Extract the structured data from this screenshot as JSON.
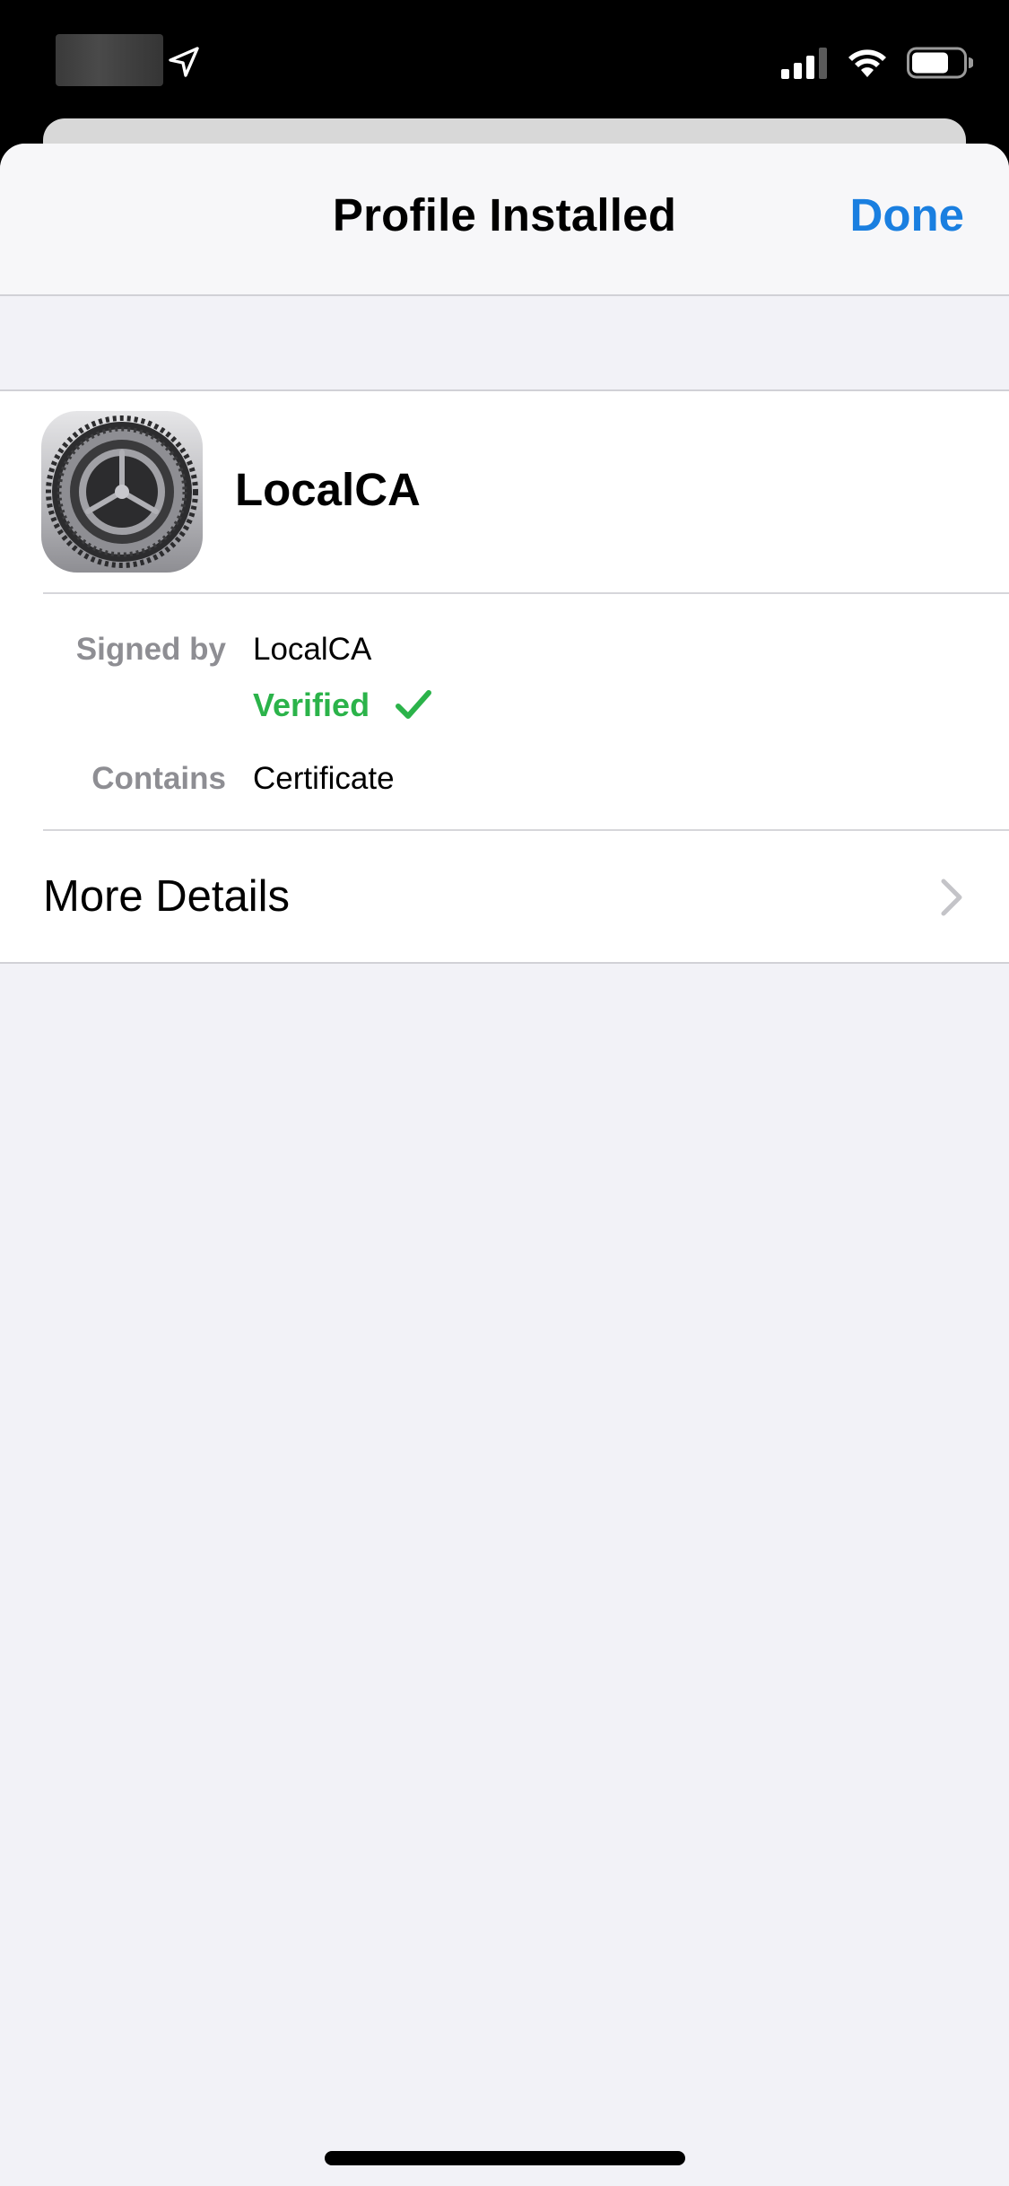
{
  "nav": {
    "title": "Profile Installed",
    "done_label": "Done"
  },
  "profile": {
    "name": "LocalCA"
  },
  "details": {
    "signed_by_label": "Signed by",
    "signed_by_value": "LocalCA",
    "verified_label": "Verified",
    "contains_label": "Contains",
    "contains_value": "Certificate"
  },
  "more_details": {
    "label": "More Details"
  },
  "colors": {
    "accent": "#1a7fe0",
    "verified": "#2bb34a",
    "secondary_text": "#8e8e93",
    "background": "#f2f2f7"
  },
  "icons": [
    "location-arrow-icon",
    "cellular-signal-icon",
    "wifi-icon",
    "battery-icon",
    "settings-gear-icon",
    "checkmark-icon",
    "chevron-right-icon"
  ]
}
